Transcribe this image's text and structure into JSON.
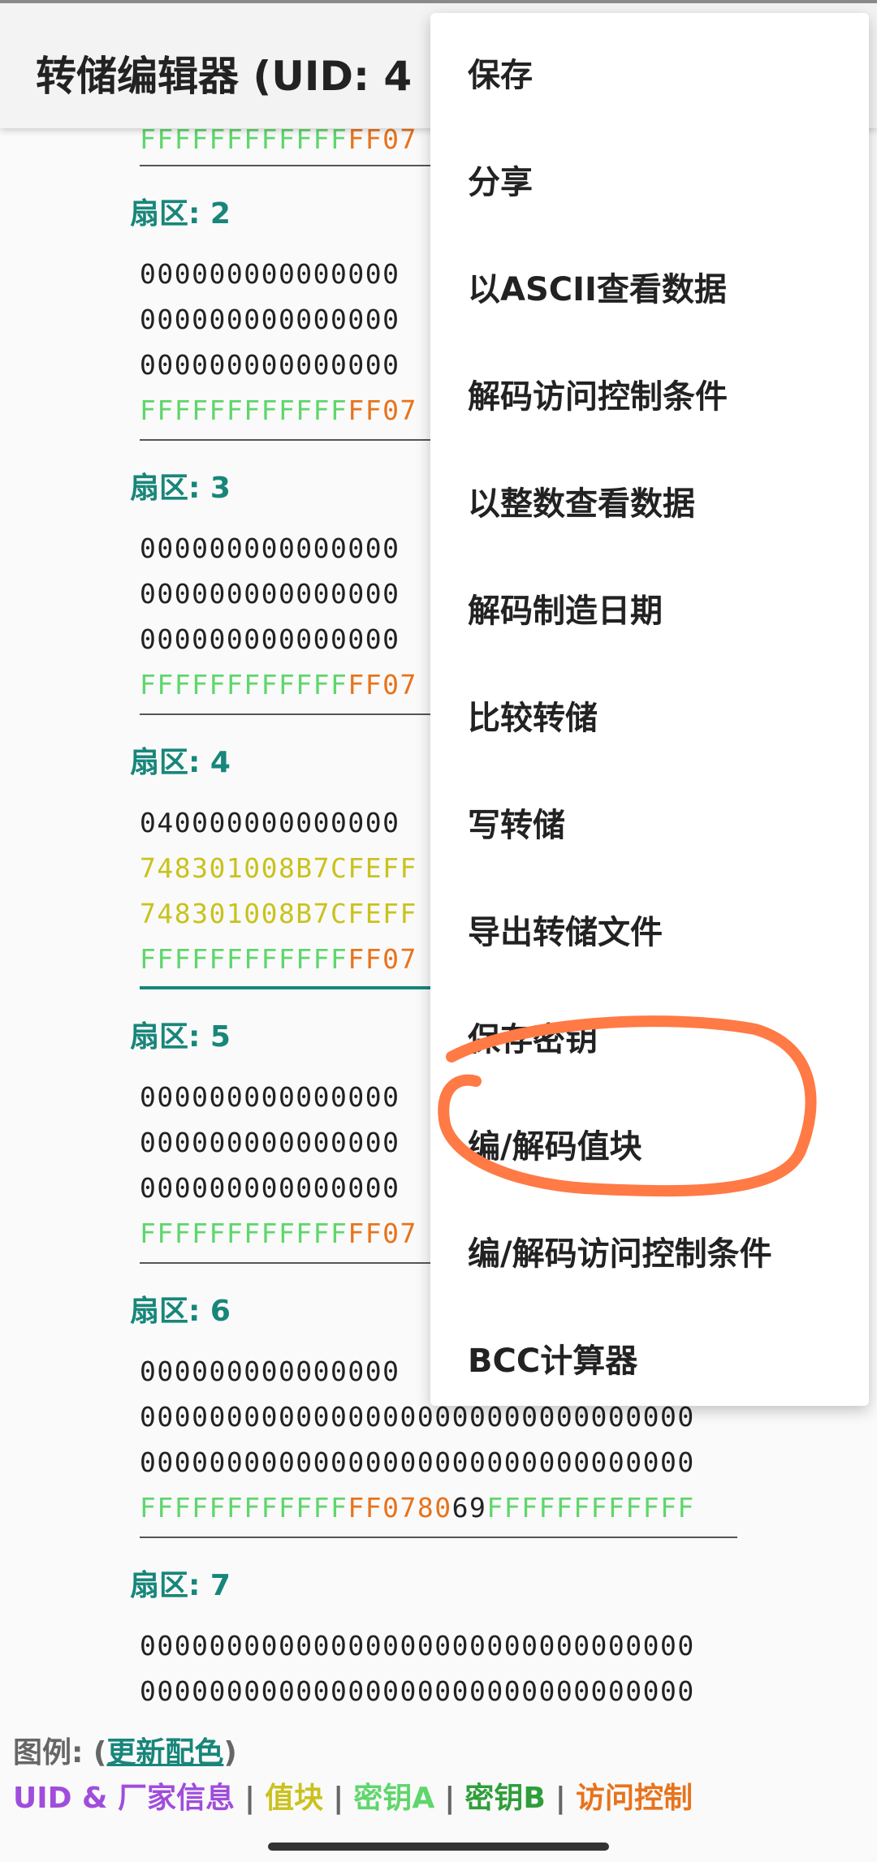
{
  "toolbar": {
    "title": "转储编辑器 (UID: 4"
  },
  "sectors": [
    {
      "label": "",
      "rows": [
        [
          [
            "g",
            "FFFFFFFFFFFF"
          ],
          [
            "o",
            "FF07"
          ]
        ]
      ]
    },
    {
      "label": "扇区: 2",
      "rows": [
        [
          [
            "k",
            "000000000000000"
          ]
        ],
        [
          [
            "k",
            "000000000000000"
          ]
        ],
        [
          [
            "k",
            "000000000000000"
          ]
        ],
        [
          [
            "g",
            "FFFFFFFFFFFF"
          ],
          [
            "o",
            "FF07"
          ]
        ]
      ]
    },
    {
      "label": "扇区: 3",
      "rows": [
        [
          [
            "k",
            "000000000000000"
          ]
        ],
        [
          [
            "k",
            "000000000000000"
          ]
        ],
        [
          [
            "k",
            "000000000000000"
          ]
        ],
        [
          [
            "g",
            "FFFFFFFFFFFF"
          ],
          [
            "o",
            "FF07"
          ]
        ]
      ]
    },
    {
      "label": "扇区: 4",
      "rows": [
        [
          [
            "k",
            "040000000000000"
          ]
        ],
        [
          [
            "y",
            "748301008B7CFEFF"
          ]
        ],
        [
          [
            "y",
            "748301008B7CFEFF"
          ]
        ],
        [
          [
            "g",
            "FFFFFFFFFFFF"
          ],
          [
            "o",
            "FF07"
          ]
        ]
      ]
    },
    {
      "label": "扇区: 5",
      "rows": [
        [
          [
            "k",
            "000000000000000"
          ]
        ],
        [
          [
            "k",
            "000000000000000"
          ]
        ],
        [
          [
            "k",
            "000000000000000"
          ]
        ],
        [
          [
            "g",
            "FFFFFFFFFFFF"
          ],
          [
            "o",
            "FF07"
          ]
        ]
      ]
    },
    {
      "label": "扇区: 6",
      "rows": [
        [
          [
            "k",
            "000000000000000"
          ]
        ],
        [
          [
            "k",
            "00000000000000000000000000000000"
          ]
        ],
        [
          [
            "k",
            "00000000000000000000000000000000"
          ]
        ],
        [
          [
            "g",
            "FFFFFFFFFFFF"
          ],
          [
            "o",
            "FF0780"
          ],
          [
            "k",
            "69"
          ],
          [
            "g",
            "FFFFFFFFFFFF"
          ]
        ]
      ]
    },
    {
      "label": "扇区: 7",
      "rows": [
        [
          [
            "k",
            "00000000000000000000000000000000"
          ]
        ],
        [
          [
            "k",
            "00000000000000000000000000000000"
          ]
        ]
      ]
    }
  ],
  "legend": {
    "prefix": "图例: (",
    "update_link": "更新配色",
    "suffix": ")",
    "items": [
      "UID & 厂家信息",
      "值块",
      "密钥A",
      "密钥B",
      "访问控制"
    ],
    "separator": "|"
  },
  "menu": {
    "items": [
      "保存",
      "分享",
      "以ASCII查看数据",
      "解码访问控制条件",
      "以整数查看数据",
      "解码制造日期",
      "比较转储",
      "写转储",
      "导出转储文件",
      "保存密钥",
      "编/解码值块",
      "编/解码访问控制条件",
      "BCC计算器"
    ]
  },
  "colors": {
    "sector_label": "#18867a",
    "key_a": "#5fd66c",
    "access": "#e8731c",
    "value_block": "#c9c21e",
    "uid": "#a04ddb",
    "key_b": "#2f9e3a",
    "annotation": "#ff7a45"
  }
}
